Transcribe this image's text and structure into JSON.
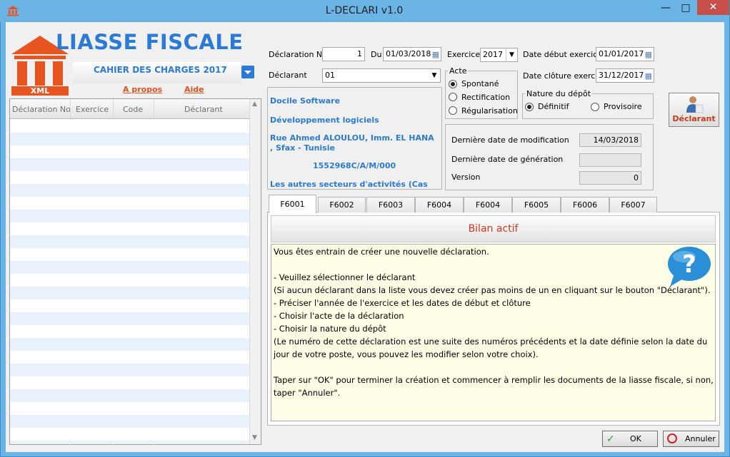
{
  "window": {
    "title": "L-DECLARI v1.0",
    "minimize": "—",
    "maximize": "□",
    "close": "✕"
  },
  "brand": {
    "title": "LIASSE FISCALE",
    "logo_text": "XML",
    "subtitle": "CAHIER DES CHARGES 2017",
    "link_about": "A propos",
    "link_help": "Aide"
  },
  "grid": {
    "columns": [
      "Déclaration No",
      "Exercice",
      "Code",
      "Déclarant"
    ]
  },
  "form": {
    "declaration_no_label": "Déclaration No",
    "declaration_no": "1",
    "du_label": "Du",
    "du_date": "01/03/2018",
    "exercice_label": "Exercice",
    "exercice": "2017",
    "date_debut_label": "Date début exercice",
    "date_debut": "01/01/2017",
    "date_cloture_label": "Date clôture exercice",
    "date_cloture": "31/12/2017",
    "declarant_label": "Déclarant",
    "declarant": "01"
  },
  "company": {
    "name": "Docile Software",
    "activity": "Développement logiciels",
    "address": "Rue Ahmed ALOULOU, Imm. EL HANA , Sfax - Tunisie",
    "tax_id": "1552968C/A/M/000",
    "sector": "Les autres secteurs d'activités (Cas"
  },
  "acte": {
    "title": "Acte",
    "options": [
      "Spontané",
      "Rectification",
      "Régularisation"
    ],
    "selected": "Spontané"
  },
  "nature": {
    "title": "Nature du dépôt",
    "options": [
      "Définitif",
      "Provisoire"
    ],
    "selected": "Définitif"
  },
  "declarant_button": "Déclarant",
  "stats": {
    "last_modif_label": "Dernière date de modification",
    "last_modif": "14/03/2018",
    "last_gen_label": "Dernière date de génération",
    "last_gen": "",
    "version_label": "Version",
    "version": "0"
  },
  "tabs": [
    "F6001",
    "F6002",
    "F6003",
    "F6004",
    "F6004",
    "F6005",
    "F6006",
    "F6007"
  ],
  "panel": {
    "header": "Bilan actif",
    "lines": [
      "Vous êtes entrain de créer une nouvelle déclaration.",
      "",
      "- Veuillez sélectionner le déclarant",
      "(Si aucun déclarant dans la liste vous devez créer pas moins de un en cliquant sur le bouton \"Déclarant\").",
      "- Préciser l'année de l'exercice et les dates de début et clôture",
      "- Choisir l'acte de la déclaration",
      "- Choisir la nature du dépôt",
      "(Le numéro de cette déclaration est une suite des numéros précédents et la date définie selon la date du",
      "jour de votre poste, vous pouvez les modifier selon votre choix).",
      "",
      "Taper sur \"OK\" pour terminer la création et commencer à remplir les documents de la liasse fiscale, si non,",
      "taper \"Annuler\"."
    ]
  },
  "buttons": {
    "ok": "OK",
    "cancel": "Annuler"
  },
  "colors": {
    "brand_blue": "#2b7bd6",
    "logo_orange": "#e8541f",
    "link_orange": "#e2531b",
    "panel_bg": "#fffee6",
    "header_red": "#d9371f"
  }
}
